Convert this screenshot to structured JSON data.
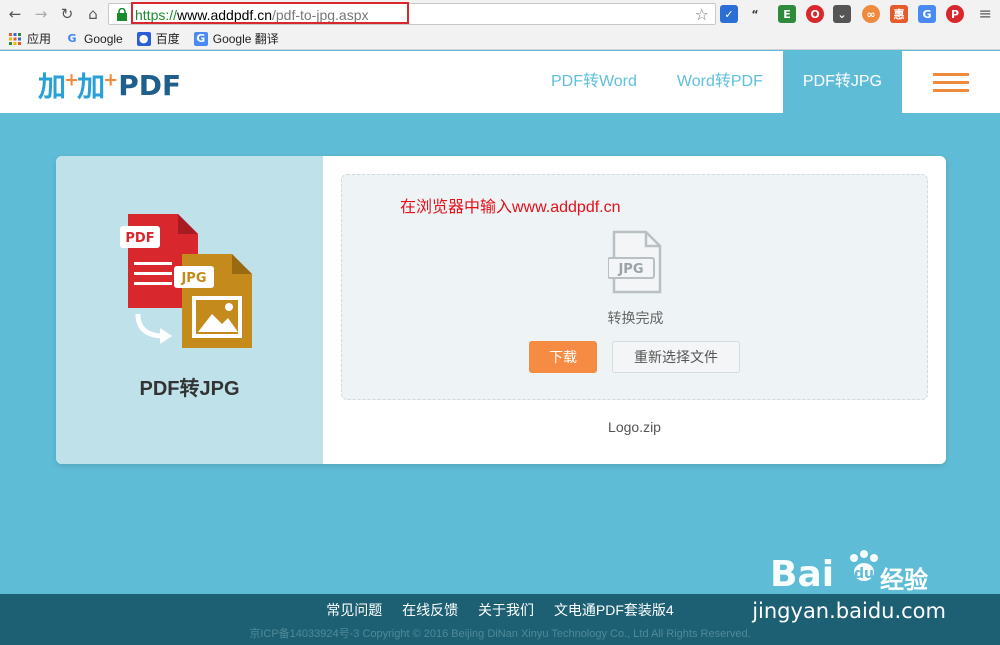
{
  "browser": {
    "url_scheme": "https://",
    "url_host": "www.addpdf.cn",
    "url_path": "/pdf-to-jpg.aspx",
    "bookmarks": [
      {
        "icon": "apps-icon",
        "label": "应用"
      },
      {
        "icon": "google-icon",
        "label": "Google"
      },
      {
        "icon": "baidu-paw-icon",
        "label": "百度"
      },
      {
        "icon": "google-translate-icon",
        "label": "Google 翻译"
      }
    ]
  },
  "site": {
    "logo_jia": "加",
    "logo_pdf": "PDF",
    "nav": [
      {
        "label": "PDF转Word",
        "active": false
      },
      {
        "label": "Word转PDF",
        "active": false
      },
      {
        "label": "PDF转JPG",
        "active": true
      }
    ]
  },
  "card": {
    "left_title": "PDF转JPG",
    "illus_pdf_label": "PDF",
    "illus_jpg_label": "JPG",
    "annotation": "在浏览器中输入www.addpdf.cn",
    "file_icon_label": "JPG",
    "status": "转换完成",
    "download_label": "下载",
    "reselect_label": "重新选择文件",
    "filename": "Logo.zip"
  },
  "footer": {
    "links": [
      "常见问题",
      "在线反馈",
      "关于我们",
      "文电通PDF套装版4"
    ],
    "copyright": "京ICP备14033924号-3 Copyright © 2016 Beijing DiNan Xinyu Technology Co., Ltd All Rights Reserved."
  },
  "watermark": {
    "brand": "Bai",
    "brand2": "du",
    "sub": "经验",
    "url": "jingyan.baidu.com"
  },
  "colors": {
    "accent_orange": "#f68b44",
    "site_blue": "#5fbcd6",
    "annotation_red": "#e2111a"
  }
}
